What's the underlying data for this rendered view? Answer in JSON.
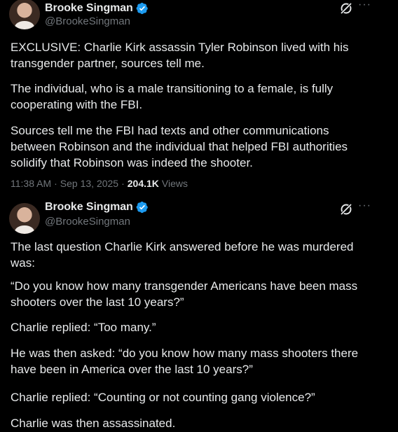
{
  "tweets": [
    {
      "author": {
        "name": "Brooke Singman",
        "handle": "@BrookeSingman",
        "verified": true
      },
      "paragraphs": [
        "EXCLUSIVE: Charlie Kirk assassin Tyler Robinson lived with his transgender partner, sources tell me.",
        "The individual, who is a male transitioning to a female, is fully cooperating with the FBI.",
        "Sources tell me the FBI had texts and other communications between Robinson and the individual that helped FBI authorities solidify that Robinson was indeed the shooter."
      ],
      "meta": {
        "time": "11:38 AM",
        "date": "Sep 13, 2025",
        "separator": "·",
        "views_count": "204.1K",
        "views_label": "Views"
      }
    },
    {
      "author": {
        "name": "Brooke Singman",
        "handle": "@BrookeSingman",
        "verified": true
      },
      "paragraphs": [
        "The last question Charlie Kirk answered before he was murdered was:",
        "“Do you know how many transgender Americans have been mass shooters over the last 10 years?”",
        "Charlie replied: “Too many.”",
        "He was then asked: “do you know how many mass shooters there have been in America over the last 10 years?”",
        "Charlie replied: “Counting or not counting gang violence?”",
        "Charlie was then assassinated."
      ]
    }
  ],
  "icons": {
    "verified": "verified-badge-icon",
    "grok": "grok-icon",
    "more": "more-options-icon"
  },
  "more_glyph": "···",
  "colors": {
    "background": "#000000",
    "text": "#e7e9ea",
    "muted": "#71767b",
    "verified": "#1d9bf0"
  }
}
